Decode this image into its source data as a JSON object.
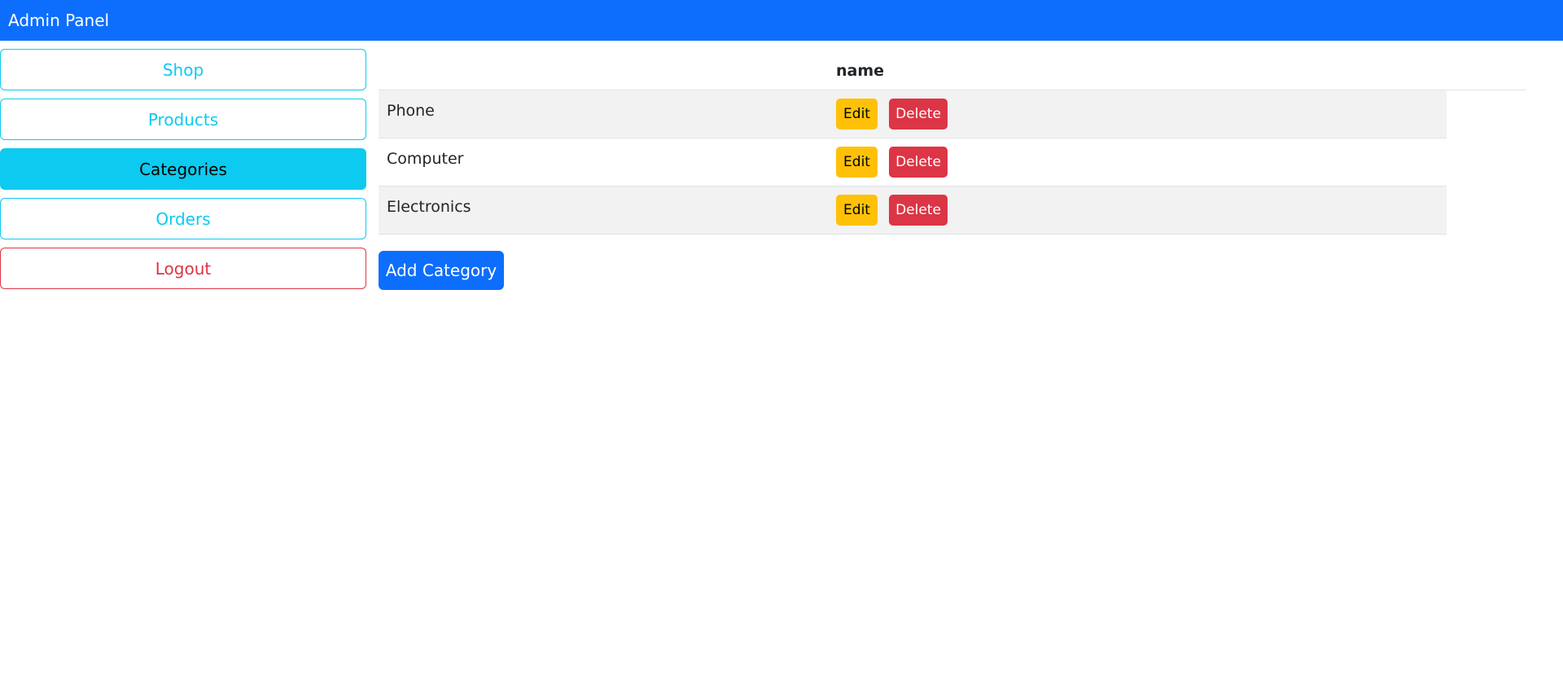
{
  "navbar": {
    "brand": "Admin Panel"
  },
  "sidebar": {
    "items": [
      {
        "label": "Shop"
      },
      {
        "label": "Products"
      },
      {
        "label": "Categories"
      },
      {
        "label": "Orders"
      },
      {
        "label": "Logout"
      }
    ]
  },
  "table": {
    "columns": [
      "name"
    ],
    "rows": [
      {
        "name": "Phone",
        "edit_label": "Edit",
        "delete_label": "Delete"
      },
      {
        "name": "Computer",
        "edit_label": "Edit",
        "delete_label": "Delete"
      },
      {
        "name": "Electronics",
        "edit_label": "Edit",
        "delete_label": "Delete"
      }
    ]
  },
  "actions": {
    "add_label": "Add Category"
  },
  "colors": {
    "primary": "#0d6efd",
    "info": "#0dcaf0",
    "warning": "#ffc107",
    "danger": "#dc3545"
  }
}
